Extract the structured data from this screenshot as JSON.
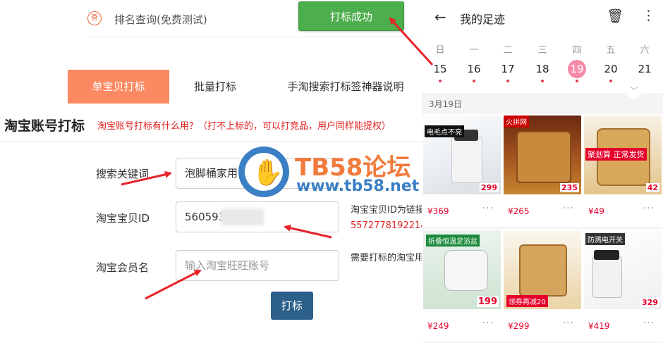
{
  "top": {
    "rank_icon": "查",
    "rank_link": "排名查询(免费测试)",
    "success_button": "打标成功"
  },
  "tabs": [
    {
      "label": "单宝贝打标"
    },
    {
      "label": "批量打标"
    },
    {
      "label": "手淘搜索打标签神器说明"
    }
  ],
  "section": {
    "title": "淘宝账号打标",
    "note": "淘宝账号打标有什么用？（打不上标的，可以打竞品，用户同样能提权）"
  },
  "form": {
    "keyword_label": "搜索关键词",
    "keyword_value": "泡脚桶家用",
    "item_id_label": "淘宝宝贝ID",
    "item_id_value": "560593",
    "member_label": "淘宝会员名",
    "member_placeholder": "输入淘宝旺旺账号",
    "help_item_id": "淘宝宝贝ID为链接",
    "help_item_id_example": "557277819221&",
    "help_member": "需要打标的淘宝用",
    "submit_label": "打标"
  },
  "watermark": {
    "name": "TB58论坛",
    "url": "www.tb58.net"
  },
  "phone": {
    "title": "我的足迹",
    "weekdays": [
      "日",
      "一",
      "二",
      "三",
      "四",
      "五",
      "六"
    ],
    "dates": [
      "15",
      "16",
      "17",
      "18",
      "19",
      "20",
      "21"
    ],
    "selected_date": "19",
    "section_date": "3月19日",
    "products": [
      {
        "price": "¥369",
        "badge": "电毛点不亮",
        "tag": "299"
      },
      {
        "price": "¥265",
        "badge": "火拼网",
        "tag": "235"
      },
      {
        "price": "¥49",
        "badge": "聚划算 正常发货",
        "tag": "42"
      },
      {
        "price": "¥249",
        "badge": "折叠恒温足浴盆",
        "tag": "199"
      },
      {
        "price": "¥299",
        "badge": "领券再减20",
        "tag": ""
      },
      {
        "price": "¥419",
        "badge": "防溅电开关",
        "tag": "329"
      }
    ]
  },
  "colors": {
    "tab_active": "#fb8a63",
    "success": "#4cae4c",
    "submit": "#2c5f8a",
    "price": "#e4002b",
    "arrow": "#e8232a"
  },
  "icons": [
    "rank-icon",
    "back-arrow-icon",
    "trash-icon",
    "more-vertical-icon",
    "chevron-down-icon",
    "hand-logo-icon"
  ]
}
